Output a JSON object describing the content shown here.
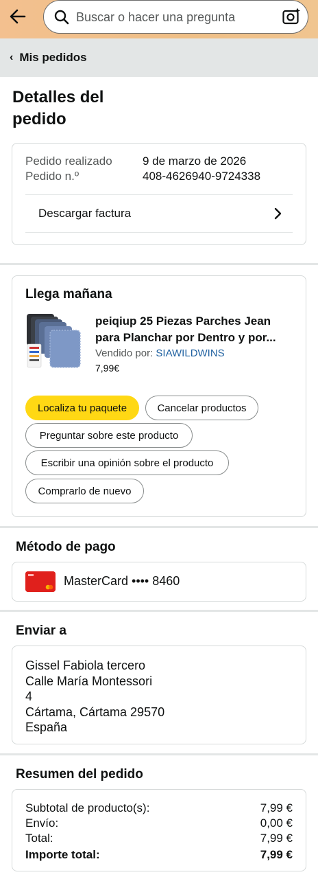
{
  "search": {
    "placeholder": "Buscar o hacer una pregunta"
  },
  "breadcrumb": {
    "label": "Mis pedidos"
  },
  "page": {
    "title": "Detalles del pedido"
  },
  "order_info": {
    "placed_label": "Pedido realizado",
    "placed_value": "9 de marzo de 2026",
    "number_label": "Pedido n.º",
    "number_value": "408-4626940-9724338",
    "invoice_link": "Descargar factura"
  },
  "shipment": {
    "heading": "Llega mañana",
    "product_title": "peiqiup 25 Piezas Parches Jean para Planchar por Dentro y por...",
    "sold_by_label": "Vendido por: ",
    "seller": "SIAWILDWINS",
    "price": "7,99€",
    "buttons": {
      "track": "Localiza tu paquete",
      "cancel": "Cancelar productos",
      "ask": "Preguntar sobre este producto",
      "review": "Escribir una opinión sobre el producto",
      "rebuy": "Comprarlo de nuevo"
    }
  },
  "payment": {
    "heading": "Método de pago",
    "card_text": "MasterCard •••• 8460"
  },
  "shipping": {
    "heading": "Enviar a",
    "lines": [
      "Gissel Fabiola tercero",
      "Calle María Montessori",
      "4",
      "Cártama, Cártama 29570",
      "España"
    ]
  },
  "summary": {
    "heading": "Resumen del pedido",
    "rows": [
      {
        "label": "Subtotal de producto(s):",
        "value": "7,99 €"
      },
      {
        "label": "Envío:",
        "value": "0,00 €"
      },
      {
        "label": "Total:",
        "value": "7,99 €"
      },
      {
        "label": "Importe total:",
        "value": "7,99 €"
      }
    ]
  },
  "colors": {
    "accent_yellow": "#ffd814",
    "link_blue": "#2162a1",
    "header_orange": "#f0c08a",
    "card_red": "#e0201c"
  }
}
